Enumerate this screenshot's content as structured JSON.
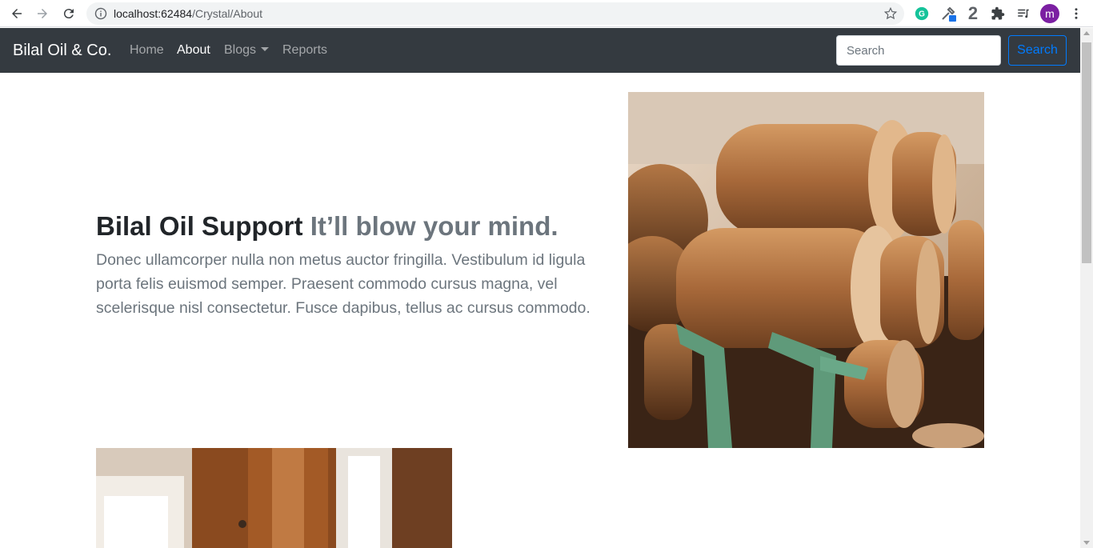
{
  "browser": {
    "url_host": "localhost:62484",
    "url_path": "/Crystal/About",
    "profile_initial": "m",
    "ext_badge": "2"
  },
  "navbar": {
    "brand": "Bilal Oil & Co.",
    "links": [
      "Home",
      "About",
      "Blogs",
      "Reports"
    ],
    "active_link": "About",
    "search_placeholder": "Search",
    "search_button": "Search"
  },
  "featurette": {
    "heading": "Bilal Oil Support",
    "heading_muted": "It’ll blow your mind.",
    "lead": "Donec ullamcorper nulla non metus auctor fringilla. Vestibulum id ligula porta felis euismod semper. Praesent commodo cursus magna, vel scelerisque nisl consectetur. Fusce dapibus, tellus ac cursus commodo."
  },
  "colors": {
    "navbar_bg": "#343a40",
    "search_button": "#007bff",
    "text_muted": "#6c757d",
    "profile_avatar": "#7b1fa2",
    "grammarly": "#15c39a"
  }
}
